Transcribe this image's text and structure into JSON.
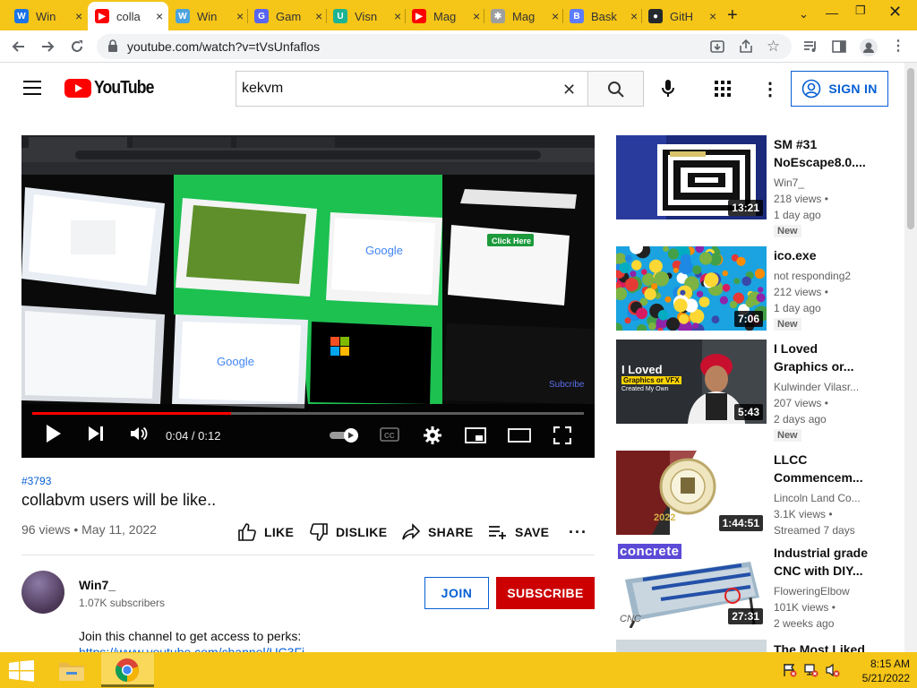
{
  "browser": {
    "tabs": [
      {
        "label": "Win",
        "color": "#1a73e8",
        "glyph": "W"
      },
      {
        "label": "colla",
        "color": "#ff0000",
        "glyph": "▶"
      },
      {
        "label": "Win",
        "color": "#4aa3df",
        "glyph": "W"
      },
      {
        "label": "Gam",
        "color": "#5865f2",
        "glyph": "G"
      },
      {
        "label": "Visn",
        "color": "#1ab394",
        "glyph": "U"
      },
      {
        "label": "Mag",
        "color": "#ff0000",
        "glyph": "▶"
      },
      {
        "label": "Mag",
        "color": "#9e9e9e",
        "glyph": "✱"
      },
      {
        "label": "Bask",
        "color": "#5c7cfa",
        "glyph": "B"
      },
      {
        "label": "GitH",
        "color": "#24292e",
        "glyph": "●"
      }
    ],
    "url": "youtube.com/watch?v=tVsUnfaflos"
  },
  "youtube": {
    "logo_text": "YouTube",
    "search_value": "kekvm",
    "signin_label": "SIGN IN"
  },
  "player": {
    "time": "0:04 / 0:12",
    "progress_fraction": 0.36,
    "watermark": "Subcribe"
  },
  "video": {
    "hashtag": "#3793",
    "title": "collabvm users will be like..",
    "meta": "96 views • May 11, 2022",
    "actions": {
      "like": "LIKE",
      "dislike": "DISLIKE",
      "share": "SHARE",
      "save": "SAVE"
    }
  },
  "channel": {
    "name": "Win7_",
    "subscribers": "1.07K subscribers",
    "join": "JOIN",
    "subscribe": "SUBSCRIBE",
    "description": "Join this channel to get access to perks:",
    "link": "https://www.youtube.com/channel/UC3Fi"
  },
  "related": [
    {
      "title": "SM #31 NoEscape8.0....",
      "channel": "Win7_",
      "views": "218 views •",
      "age": "1 day ago",
      "badge": "New",
      "duration": "13:21"
    },
    {
      "title": "ico.exe",
      "channel": "not responding2",
      "views": "212 views •",
      "age": "1 day ago",
      "badge": "New",
      "duration": "7:06"
    },
    {
      "title": "I Loved Graphics or...",
      "channel": "Kulwinder Vilasr...",
      "views": "207 views •",
      "age": "2 days ago",
      "badge": "New",
      "duration": "5:43",
      "thumb_text": "I Loved",
      "thumb_sub": "Graphics or VFX",
      "thumb_sub2": "Created My Own"
    },
    {
      "title": "LLCC Commencem...",
      "channel": "Lincoln Land Co...",
      "views": "3.1K views •",
      "age": "Streamed 7 days",
      "badge": "",
      "duration": "1:44:51"
    },
    {
      "title": "Industrial grade CNC with DIY...",
      "channel": "FloweringElbow",
      "views": "101K views •",
      "age": "2 weeks ago",
      "badge": "",
      "duration": "27:31",
      "thumb_text": "concrete",
      "thumb_sub": "CNC"
    },
    {
      "title": "The Most Liked",
      "channel": "",
      "views": "",
      "age": "",
      "badge": "",
      "duration": ""
    }
  ],
  "taskbar": {
    "time": "8:15 AM",
    "date": "5/21/2022"
  }
}
